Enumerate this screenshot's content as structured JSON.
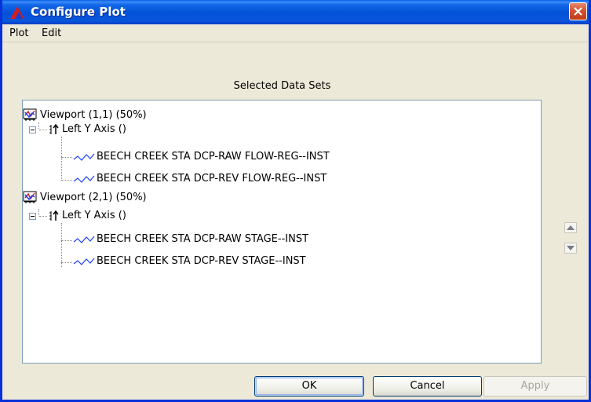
{
  "window": {
    "title": "Configure Plot",
    "close_icon": "close-icon",
    "logo_icon": "app-logo-icon"
  },
  "menu": {
    "items": [
      {
        "label": "Plot"
      },
      {
        "label": "Edit"
      }
    ]
  },
  "panel": {
    "heading": "Selected Data Sets"
  },
  "tree": {
    "viewports": [
      {
        "label": "Viewport (1,1) (50%)",
        "axis": {
          "label": "Left Y Axis ()"
        },
        "series": [
          {
            "label": "BEECH CREEK STA DCP-RAW FLOW-REG--INST"
          },
          {
            "label": "BEECH CREEK STA DCP-REV FLOW-REG--INST"
          }
        ]
      },
      {
        "label": "Viewport (2,1) (50%)",
        "axis": {
          "label": "Left Y Axis ()"
        },
        "series": [
          {
            "label": "BEECH CREEK STA DCP-RAW STAGE--INST"
          },
          {
            "label": "BEECH CREEK STA DCP-REV STAGE--INST"
          }
        ]
      }
    ]
  },
  "side_buttons": {
    "up_icon": "move-up-icon",
    "down_icon": "move-down-icon"
  },
  "buttons": {
    "ok": "OK",
    "cancel": "Cancel",
    "apply": "Apply"
  },
  "colors": {
    "titlebar": "#0251d8",
    "dialog_bg": "#ece9d8",
    "series_line": "#1a3cff"
  }
}
